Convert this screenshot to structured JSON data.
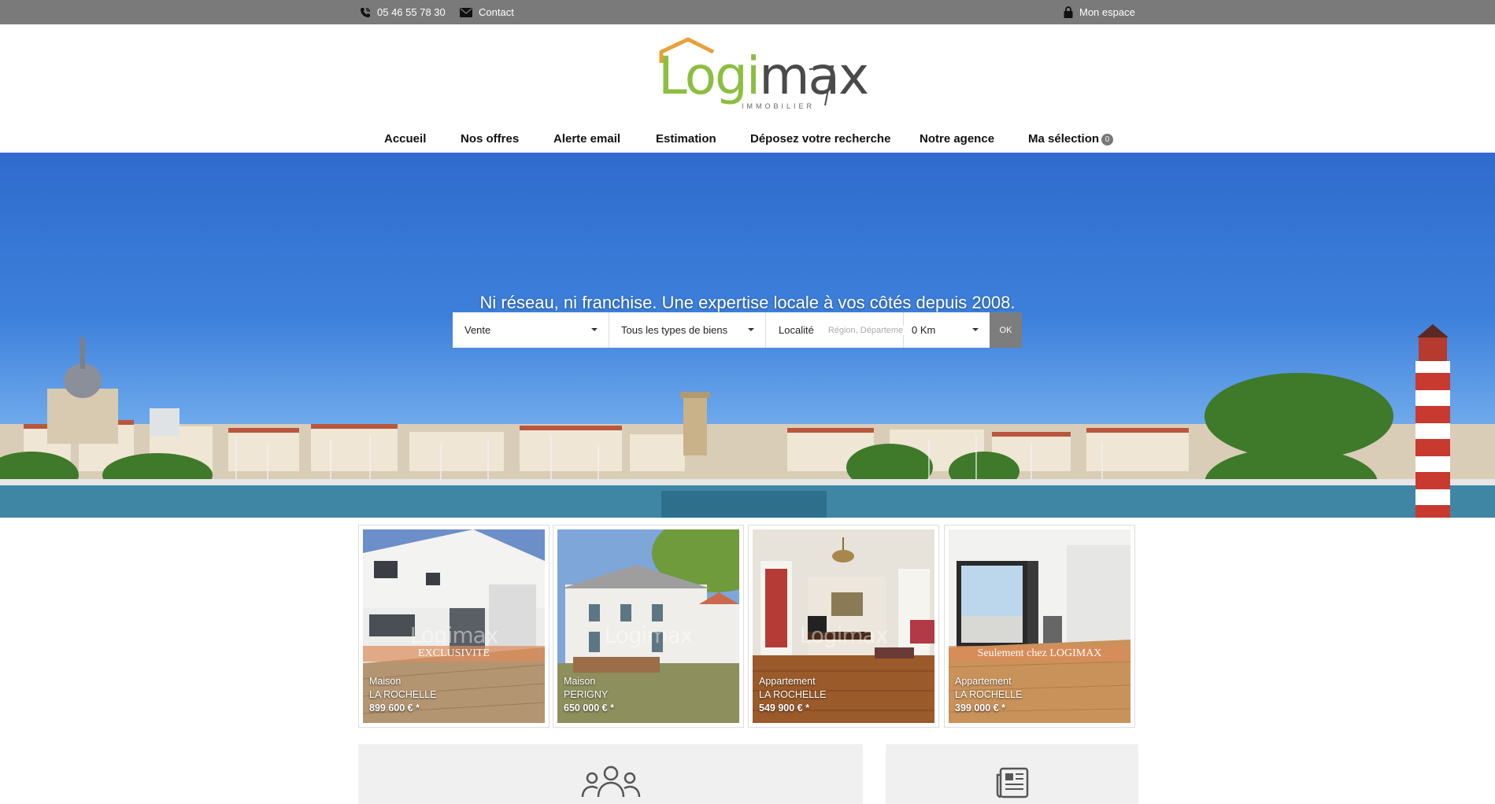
{
  "topbar": {
    "phone": "05 46 55 78 30",
    "contact": "Contact",
    "account": "Mon espace"
  },
  "brand": {
    "logo_part1": "Logi",
    "logo_part2": "max",
    "logo_sub": "IMMOBILIER",
    "green": "#8cbe3f",
    "orange": "#e8a13a"
  },
  "nav": {
    "items": [
      "Accueil",
      "Nos offres",
      "Alerte email",
      "Estimation",
      "Déposez votre recherche",
      "Notre agence",
      "Ma sélection"
    ],
    "selection_count": "0"
  },
  "hero": {
    "tagline": "Ni réseau, ni franchise. Une expertise locale à vos côtés depuis 2008."
  },
  "search": {
    "transaction": "Vente",
    "type": "Tous les types de biens",
    "location_label": "Localité",
    "location_placeholder": "Région, Département,",
    "radius": "0 Km",
    "submit": "OK"
  },
  "listings": [
    {
      "type": "Maison",
      "city": "LA ROCHELLE",
      "price": "899 600 € *",
      "ribbon": "EXCLUSIVITE",
      "watermark": "Logimax"
    },
    {
      "type": "Maison",
      "city": "PERIGNY",
      "price": "650 000 € *",
      "ribbon": "",
      "watermark": "Logimax"
    },
    {
      "type": "Appartement",
      "city": "LA ROCHELLE",
      "price": "549 900 € *",
      "ribbon": "",
      "watermark": "Logimax"
    },
    {
      "type": "Appartement",
      "city": "LA ROCHELLE",
      "price": "399 000 € *",
      "ribbon": "Seulement chez LOGIMAX",
      "watermark": ""
    }
  ],
  "icons": {
    "phone": "phone-icon",
    "contact": "envelope-icon",
    "account": "lock-icon",
    "panel_left": "users-icon",
    "panel_right": "newspaper-icon"
  }
}
